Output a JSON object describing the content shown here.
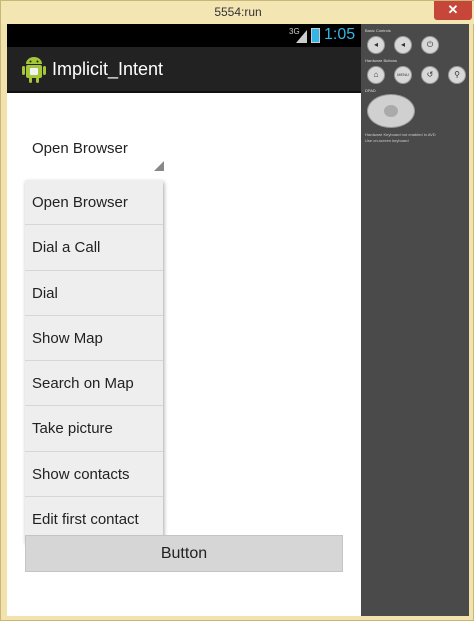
{
  "window": {
    "title": "5554:run",
    "close_glyph": "✕"
  },
  "statusbar": {
    "network": "3G",
    "time": "1:05",
    "battery_color": "#33b5e5"
  },
  "actionbar": {
    "title": "Implicit_Intent",
    "icon": "android-app-icon"
  },
  "spinner": {
    "selected": "Open Browser"
  },
  "dropdown": {
    "items": [
      "Open Browser",
      "Dial a Call",
      "Dial",
      "Show Map",
      "Search on Map",
      "Take picture",
      "Show contacts",
      "Edit first contact"
    ]
  },
  "main_button": {
    "label": "Button"
  },
  "controls": {
    "basic_heading": "Basic Controls",
    "hardware_heading": "Hardware Buttons",
    "dpad_heading": "DPAD",
    "menu_label": "MENU",
    "keyboard_note_line1": "Hardware Keyboard not enabled in AVD",
    "keyboard_note_line2": "Use on-screen keyboard"
  }
}
